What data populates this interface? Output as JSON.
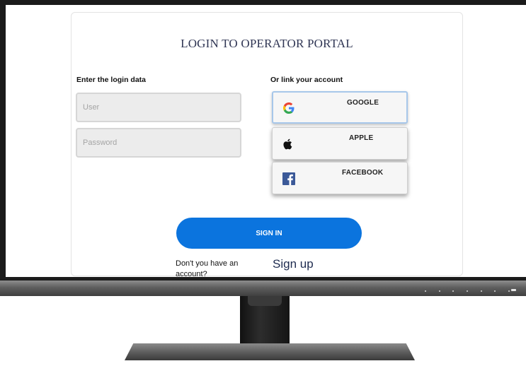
{
  "login": {
    "title": "LOGIN TO OPERATOR PORTAL",
    "left_label": "Enter the login data",
    "right_label": "Or link your account",
    "user_placeholder": "User",
    "password_placeholder": "Password",
    "social": {
      "google": {
        "label": "GOOGLE",
        "icon": "google-icon"
      },
      "apple": {
        "label": "APPLE",
        "icon": "apple-icon"
      },
      "facebook": {
        "label": "FACEBOOK",
        "icon": "facebook-icon"
      }
    },
    "signin_label": "SIGN IN",
    "no_account_text": "Don't you have an account?",
    "signup_label": "Sign up"
  },
  "colors": {
    "accent": "#0b74de",
    "title": "#2f3553",
    "facebook": "#3b5998",
    "monitor": "#1b1b1b"
  }
}
